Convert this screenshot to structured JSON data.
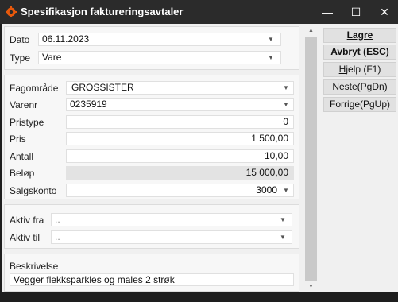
{
  "window": {
    "title": "Spesifikasjon faktureringsavtaler",
    "controls": {
      "minimize": "—",
      "maximize": "☐",
      "close": "✕"
    }
  },
  "header": {
    "dato": {
      "label": "Dato",
      "value": "06.11.2023"
    },
    "type": {
      "label": "Type",
      "value": "Vare"
    }
  },
  "details": {
    "fagomrade": {
      "label": "Fagområde",
      "value": "GROSSISTER"
    },
    "varenr": {
      "label": "Varenr",
      "value": "0235919"
    },
    "pristype": {
      "label": "Pristype",
      "value": "0"
    },
    "pris": {
      "label": "Pris",
      "value": "1 500,00"
    },
    "antall": {
      "label": "Antall",
      "value": "10,00"
    },
    "belop": {
      "label": "Beløp",
      "value": "15 000,00"
    },
    "salgskonto": {
      "label": "Salgskonto",
      "value": "3000"
    }
  },
  "period": {
    "aktiv_fra": {
      "label": "Aktiv fra",
      "value": ".."
    },
    "aktiv_til": {
      "label": "Aktiv til",
      "value": ".."
    }
  },
  "description": {
    "label": "Beskrivelse",
    "value": "Vegger flekksparkles og males 2 strøk"
  },
  "actions": {
    "lagre": {
      "label": "Lagre"
    },
    "avbryt": {
      "label": "Avbryt (ESC)"
    },
    "hjelp": {
      "mnemonic": "H",
      "rest": "jelp (F1)"
    },
    "neste": {
      "label": "Neste(PgDn)"
    },
    "forrige": {
      "label": "Forrige(PgUp)"
    }
  },
  "icons": {
    "app": "orange-gear-icon",
    "dropdown": "chevron-down-icon"
  },
  "colors": {
    "titlebar": "#2b2b2b",
    "accent": "#e8590c",
    "readonly_field": "#e3e3e3"
  }
}
